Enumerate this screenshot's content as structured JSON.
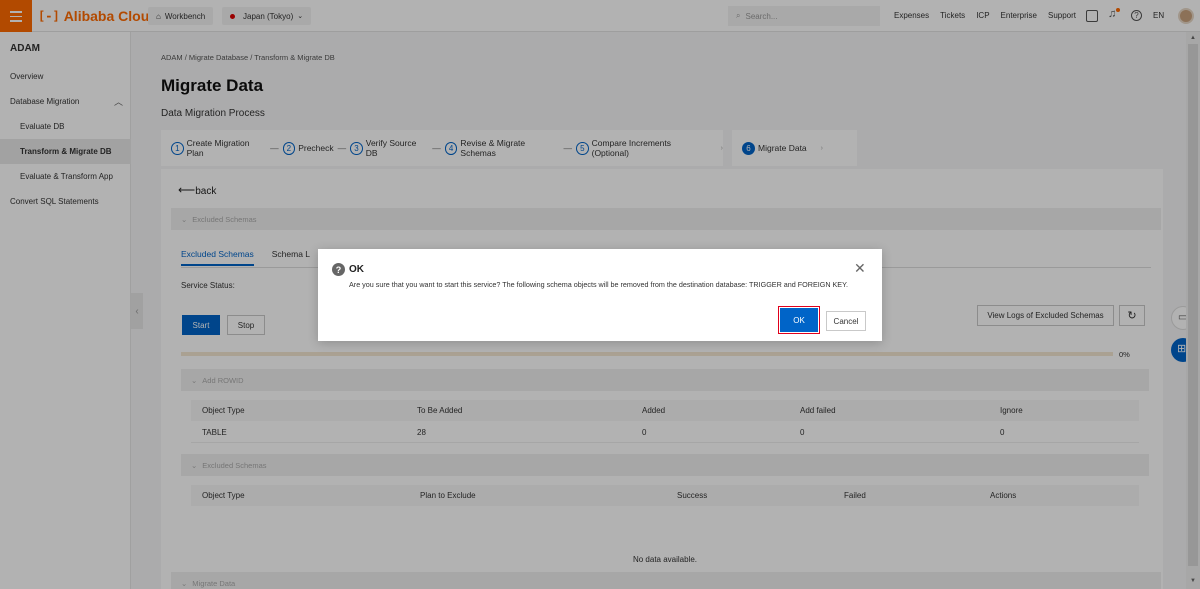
{
  "topbar": {
    "logo": "Alibaba Cloud",
    "workbench": "Workbench",
    "region": "Japan (Tokyo)",
    "search_placeholder": "Search...",
    "links": [
      "Expenses",
      "Tickets",
      "ICP",
      "Enterprise",
      "Support"
    ],
    "lang": "EN"
  },
  "sidebar": {
    "title": "ADAM",
    "items": [
      {
        "label": "Overview"
      },
      {
        "label": "Database Migration"
      },
      {
        "label": "Evaluate DB"
      },
      {
        "label": "Transform & Migrate DB"
      },
      {
        "label": "Evaluate & Transform App"
      },
      {
        "label": "Convert SQL Statements"
      }
    ]
  },
  "main": {
    "breadcrumb": "ADAM  /  Migrate Database  /  Transform & Migrate DB",
    "title": "Migrate Data",
    "subtitle": "Data Migration Process",
    "steps": [
      {
        "num": "1",
        "label": "Create Migration Plan"
      },
      {
        "num": "2",
        "label": "Precheck"
      },
      {
        "num": "3",
        "label": "Verify Source DB"
      },
      {
        "num": "4",
        "label": "Revise & Migrate Schemas"
      },
      {
        "num": "5",
        "label": "Compare Increments (Optional)"
      },
      {
        "num": "6",
        "label": "Migrate Data"
      }
    ],
    "back": "back",
    "panel_excluded": "Excluded Schemas",
    "tabs": [
      "Excluded Schemas",
      "Schema L"
    ],
    "service_status": "Service Status:",
    "start": "Start",
    "stop": "Stop",
    "view_logs": "View Logs of Excluded Schemas",
    "progress_value": 0,
    "progress_label": "0%",
    "panel_rowid": "Add ROWID",
    "rowid_table": {
      "headers": [
        "Object Type",
        "To Be Added",
        "Added",
        "Add failed",
        "Ignore"
      ],
      "rows": [
        [
          "TABLE",
          "28",
          "0",
          "0",
          "0"
        ]
      ]
    },
    "panel_excluded2": "Excluded Schemas",
    "excluded_table": {
      "headers": [
        "Object Type",
        "Plan to Exclude",
        "Success",
        "Failed",
        "Actions"
      ],
      "empty": "No data available."
    },
    "panel_migrate": "Migrate Data"
  },
  "dialog": {
    "title": "OK",
    "message": "Are you sure that you want to start this service? The following schema objects will be removed from the destination database: TRIGGER and FOREIGN KEY.",
    "ok": "OK",
    "cancel": "Cancel"
  }
}
